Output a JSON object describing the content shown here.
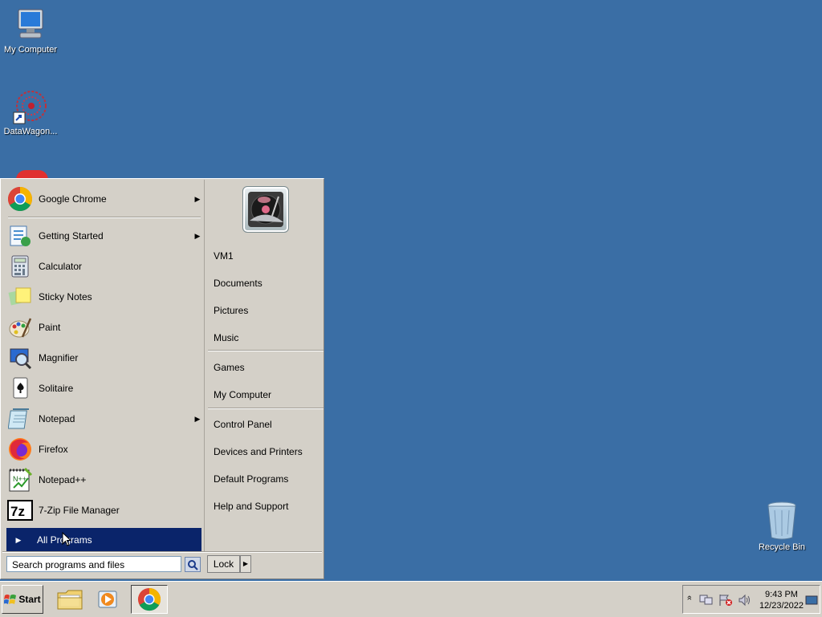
{
  "desktop": {
    "icons": [
      {
        "label": "My Computer"
      },
      {
        "label": "DataWagon..."
      },
      {
        "label": "Recycle Bin"
      }
    ]
  },
  "start_menu": {
    "pinned": [
      {
        "label": "Google Chrome",
        "icon": "chrome-icon",
        "has_submenu": true
      }
    ],
    "programs": [
      {
        "label": "Getting Started",
        "icon": "getting-started-icon",
        "has_submenu": true
      },
      {
        "label": "Calculator",
        "icon": "calculator-icon",
        "has_submenu": false
      },
      {
        "label": "Sticky Notes",
        "icon": "sticky-notes-icon",
        "has_submenu": false
      },
      {
        "label": "Paint",
        "icon": "paint-icon",
        "has_submenu": false
      },
      {
        "label": "Magnifier",
        "icon": "magnifier-icon",
        "has_submenu": false
      },
      {
        "label": "Solitaire",
        "icon": "solitaire-icon",
        "has_submenu": false
      },
      {
        "label": "Notepad",
        "icon": "notepad-icon",
        "has_submenu": true
      },
      {
        "label": "Firefox",
        "icon": "firefox-icon",
        "has_submenu": false
      },
      {
        "label": "Notepad++",
        "icon": "notepadpp-icon",
        "has_submenu": false
      },
      {
        "label": "7-Zip File Manager",
        "icon": "7zip-icon",
        "has_submenu": false
      }
    ],
    "all_programs": "All Programs",
    "right": {
      "group1": [
        "VM1",
        "Documents",
        "Pictures",
        "Music"
      ],
      "group2": [
        "Games",
        "My Computer"
      ],
      "group3": [
        "Control Panel",
        "Devices and Printers",
        "Default Programs",
        "Help and Support"
      ]
    },
    "search_placeholder": "Search programs and files",
    "lock_label": "Lock"
  },
  "taskbar": {
    "start_label": "Start",
    "clock_time": "9:43 PM",
    "clock_date": "12/23/2022",
    "tray_expand": "»"
  },
  "colors": {
    "desktop": "#3a6ea5",
    "highlight": "#0a246a"
  }
}
